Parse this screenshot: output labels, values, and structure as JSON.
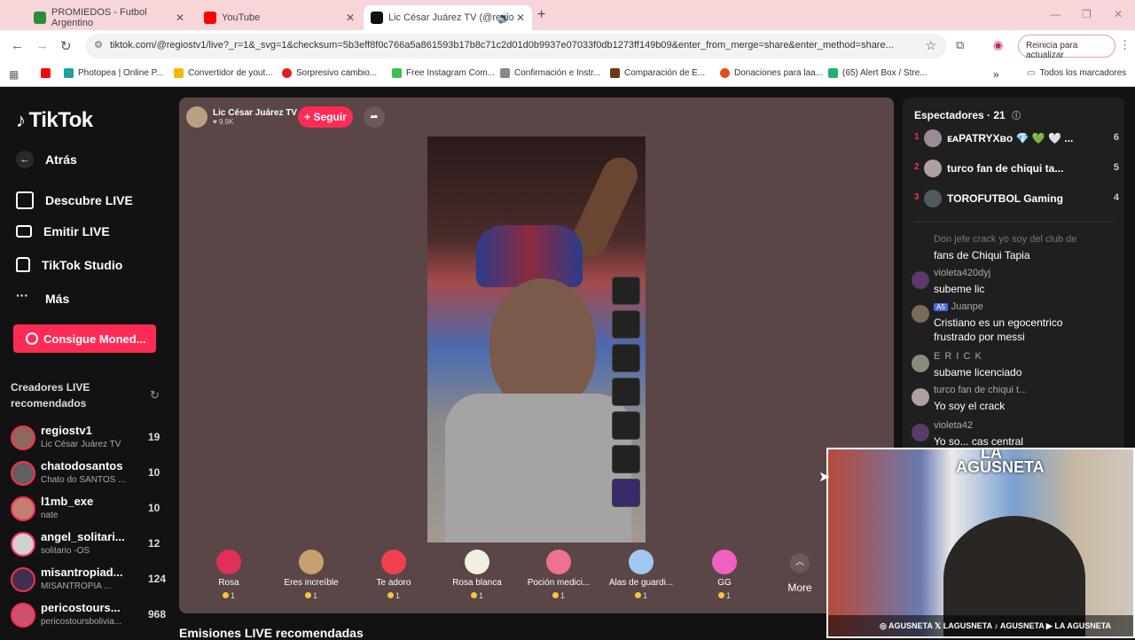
{
  "browser": {
    "tabs": [
      {
        "title": "PROMIEDOS - Futbol Argentino",
        "color": "#2e8b3e"
      },
      {
        "title": "YouTube",
        "color": "#ff0000"
      },
      {
        "title": "Lic César Juárez TV (@regio",
        "color": "#111111"
      }
    ],
    "add_tab": "+",
    "url": "tiktok.com/@regiostv1/live?_r=1&_svg=1&checksum=5b3eff8f0c766a5a861593b17b8c71c2d01d0b9937e07033f0db1273ff149b09&enter_from_merge=share&enter_method=share...",
    "update_button": "Reinicia para actualizar",
    "bookmarks": [
      {
        "label": "",
        "color": "#ff0000"
      },
      {
        "label": "Photopea | Online P...",
        "color": "#1fa39a"
      },
      {
        "label": "Convertidor de yout...",
        "color": "#f5b800"
      },
      {
        "label": "Sorpresivo cambio...",
        "color": "#e02020"
      },
      {
        "label": "Free Instagram Com...",
        "color": "#3cc050"
      },
      {
        "label": "Confirmación e Instr...",
        "color": "#888888"
      },
      {
        "label": "Comparación de E...",
        "color": "#6a3a10"
      },
      {
        "label": "Donaciones para laa...",
        "color": "#e05020"
      },
      {
        "label": "(65) Alert Box / Stre...",
        "color": "#20b070"
      }
    ],
    "bookmarks_more": "»",
    "all_bookmarks": "Todos los marcadores"
  },
  "sidebar": {
    "logo": "TikTok",
    "back": "Atrás",
    "nav": [
      "Descubre LIVE",
      "Emitir LIVE",
      "TikTok Studio",
      "Más"
    ],
    "coins_button": "Consigue Moned...",
    "section_title": "Creadores LIVE recomendados",
    "creators": [
      {
        "name": "regiostv1",
        "sub": "Lic César Juárez TV",
        "count": "19"
      },
      {
        "name": "chatodosantos",
        "sub": "Chato do SANTOS ...",
        "count": "10"
      },
      {
        "name": "l1mb_exe",
        "sub": "nate",
        "count": "10"
      },
      {
        "name": "angel_solitari...",
        "sub": "solitario -OS",
        "count": "12"
      },
      {
        "name": "misantropiad...",
        "sub": "MISANTROPIA ...",
        "count": "124"
      },
      {
        "name": "pericostours...",
        "sub": "pericostoursbolivia...",
        "count": "968"
      }
    ]
  },
  "live": {
    "host_name": "Lic César Juárez TV",
    "host_likes": "♥ 9.9K",
    "follow": "+ Seguir",
    "gifts": [
      {
        "name": "Rosa",
        "coins": "1",
        "color": "#e0305a"
      },
      {
        "name": "Eres increíble",
        "coins": "1",
        "color": "#c8a070"
      },
      {
        "name": "Te adoro",
        "coins": "1",
        "color": "#f04050"
      },
      {
        "name": "Rosa blanca",
        "coins": "1",
        "color": "#f0f0e0"
      },
      {
        "name": "Poción medici...",
        "coins": "1",
        "color": "#f07090"
      },
      {
        "name": "Alas de guardi...",
        "coins": "1",
        "color": "#a0c8f0"
      },
      {
        "name": "GG",
        "coins": "1",
        "color": "#f060c0"
      }
    ],
    "more": "More",
    "recommended_title": "Emisiones LIVE recomendadas"
  },
  "chat": {
    "title": "Espectadores · 21",
    "viewers": [
      {
        "rank": "1",
        "name": "ᴇᴀPATRYXʙᴏ 💎 💚 🤍 ...",
        "count": "6"
      },
      {
        "rank": "2",
        "name": "turco fan de chiqui ta...",
        "count": "5"
      },
      {
        "rank": "3",
        "name": "TOROFUTBOL Gaming",
        "count": "4"
      }
    ],
    "messages": [
      {
        "user": "Don jefe crack yo soy del club de",
        "text": "fans de Chiqui Tapia"
      },
      {
        "user": "violeta420dyj",
        "text": "subeme lic"
      },
      {
        "user": "Juanpe",
        "text": "Cristiano es un egocentrico frustrado por messi"
      },
      {
        "user": "E R I C K",
        "text": "subame licenciado"
      },
      {
        "user": "turco fan de chiqui t...",
        "text": "Yo soy el crack"
      },
      {
        "user": "violeta42",
        "text": "Yo so... cas central"
      }
    ]
  },
  "overlay": {
    "logo": "LA AGUSNETA",
    "socials": "◎ AGUSNETA   𝕏 LAGUSNETA   ♪ AGUSNETA   ▶ LA AGUSNETA"
  }
}
